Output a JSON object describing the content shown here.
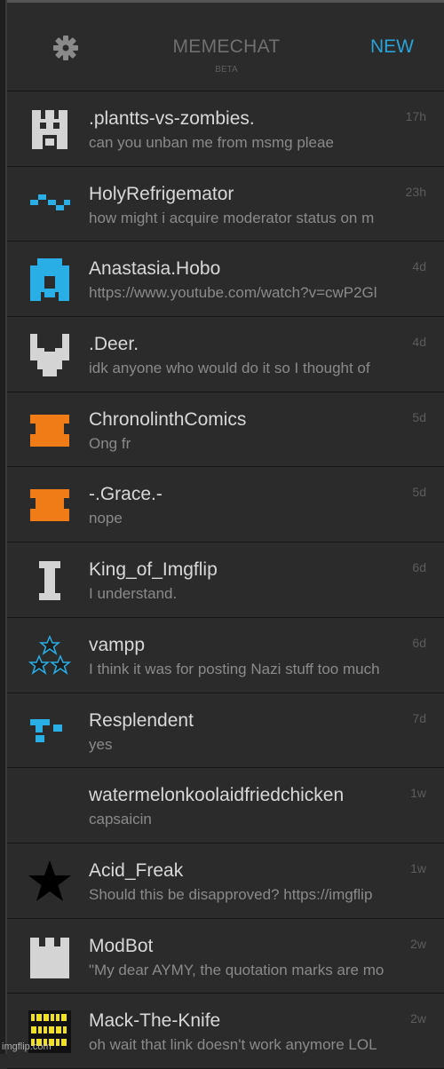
{
  "header": {
    "title": "MEMECHAT",
    "subtitle": "BETA",
    "new_label": "NEW",
    "settings_icon": "gear-icon"
  },
  "colors": {
    "accent": "#2aa3d8",
    "orange": "#f07c17",
    "gray_avatar": "#d4d4d4",
    "yellow": "#f0e020"
  },
  "conversations": [
    {
      "name": ".plantts-vs-zombies.",
      "message": "can you unban me from msmg pleae",
      "time": "17h",
      "avatar": "gray-invader-avatar"
    },
    {
      "name": "HolyRefrigemator",
      "message": "how might i acquire moderator status on m",
      "time": "23h",
      "avatar": "blue-zigzag-avatar"
    },
    {
      "name": "Anastasia.Hobo",
      "message": "https://www.youtube.com/watch?v=cwP2Gl",
      "time": "4d",
      "avatar": "blue-ghost-avatar"
    },
    {
      "name": ".Deer.",
      "message": "idk anyone who would do it so I thought of",
      "time": "4d",
      "avatar": "gray-deer-avatar"
    },
    {
      "name": "ChronolinthComics",
      "message": "Ong fr",
      "time": "5d",
      "avatar": "orange-block-avatar"
    },
    {
      "name": "-.Grace.-",
      "message": "nope",
      "time": "5d",
      "avatar": "orange-block-avatar"
    },
    {
      "name": "King_of_Imgflip",
      "message": "I understand.",
      "time": "6d",
      "avatar": "gray-i-beam-avatar"
    },
    {
      "name": "vampp",
      "message": "I think it was for posting Nazi stuff too much",
      "time": "6d",
      "avatar": "blue-stars-avatar"
    },
    {
      "name": "Resplendent",
      "message": "yes",
      "time": "7d",
      "avatar": "blue-blocks-avatar"
    },
    {
      "name": "watermelonkoolaidfriedchicken",
      "message": "capsaicin",
      "time": "1w",
      "avatar": "blank-avatar"
    },
    {
      "name": "Acid_Freak",
      "message": "Should this be disapproved? https://imgflip",
      "time": "1w",
      "avatar": "black-star-avatar"
    },
    {
      "name": "ModBot",
      "message": "\"My dear AYMY, the quotation marks are mo",
      "time": "2w",
      "avatar": "gray-castle-avatar"
    },
    {
      "name": "Mack-The-Knife",
      "message": "oh wait that link doesn't work anymore LOL",
      "time": "2w",
      "avatar": "binary-avatar"
    }
  ],
  "watermark": "imgflip.com"
}
